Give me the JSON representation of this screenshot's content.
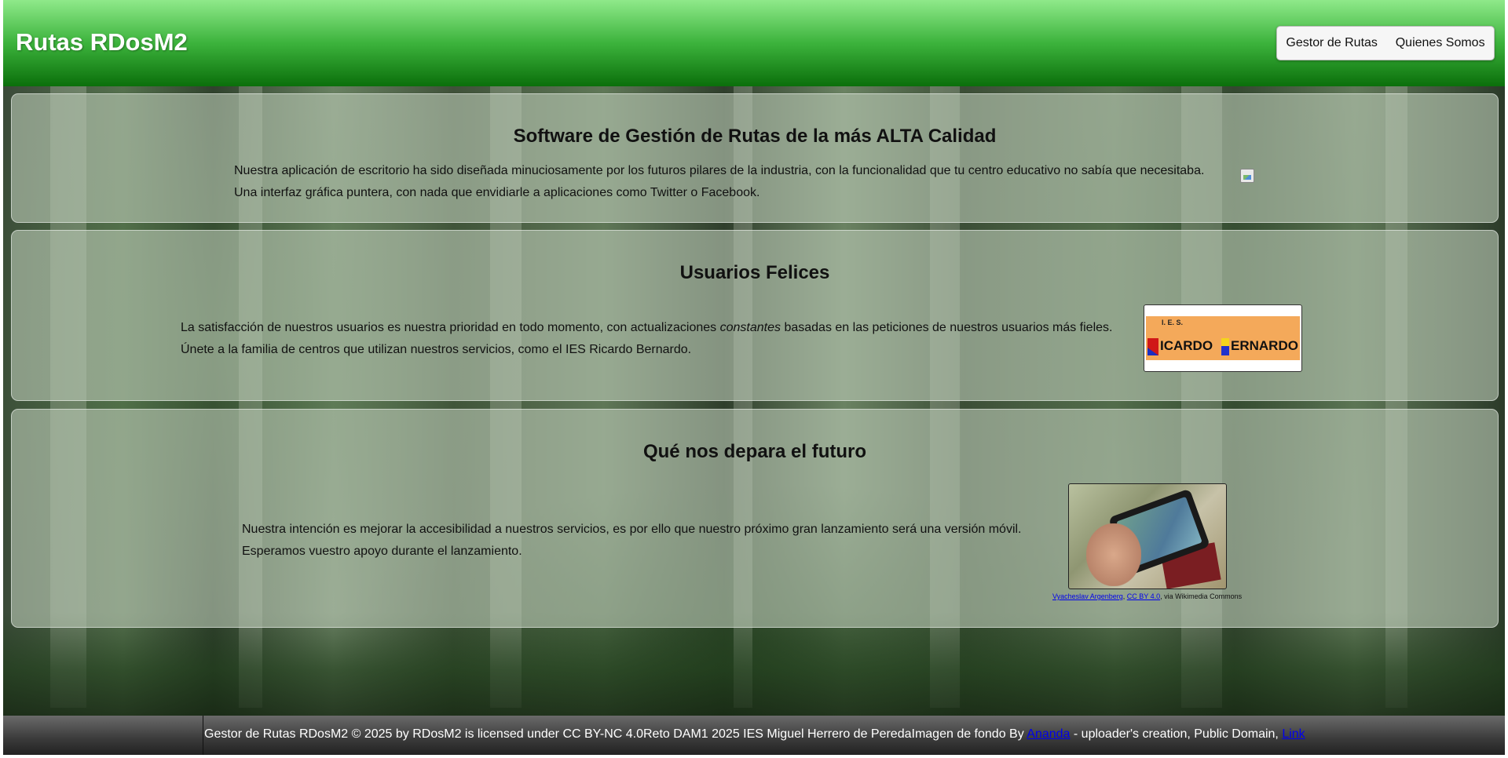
{
  "header": {
    "brand": "Rutas RDosM2",
    "nav": [
      "Gestor de Rutas",
      "Quienes Somos"
    ]
  },
  "sections": [
    {
      "title": "Software de Gestión de Rutas de la más ALTA Calidad",
      "line1": "Nuestra aplicación de escritorio ha sido diseñada minuciosamente por los futuros pilares de la industria, con la funcionalidad que tu centro educativo no sabía que necesitaba.",
      "line2": "Una interfaz gráfica puntera, con nada que envidiarle a aplicaciones como Twitter o Facebook."
    },
    {
      "title": "Usuarios Felices",
      "line1_pre": "La satisfacción de nuestros usuarios es nuestra prioridad en todo momento, con actualizaciones ",
      "line1_em": "constantes",
      "line1_post": " basadas en las peticiones de nuestros usuarios más fieles.",
      "line2": "Únete a la familia de centros que utilizan nuestros servicios, como el IES Ricardo Bernardo.",
      "logo": {
        "small": "I. E. S.",
        "big_1": "ICARDO",
        "big_2": "ERNARDO"
      }
    },
    {
      "title": "Qué nos depara el futuro",
      "line1": "Nuestra intención es mejorar la accesibilidad a nuestros servicios, es por ello que nuestro próximo gran lanzamiento será una versión móvil.",
      "line2": "Esperamos vuestro apoyo durante el lanzamiento.",
      "caption": {
        "author": "Vyacheslav Argenberg",
        "sep": ", ",
        "license": "CC BY 4.0",
        "suffix": ", via Wikimedia Commons"
      }
    }
  ],
  "footer": {
    "text": "Gestor de Rutas RDosM2 © 2025 by RDosM2 is licensed under CC BY-NC 4.0Reto DAM1 2025 IES Miguel Herrero de PeredaImagen de fondo By ",
    "author_link": "Ananda",
    "middle": " - uploader's creation, Public Domain, ",
    "link": "Link"
  },
  "colors": {
    "header_top": "#8fe98a",
    "header_bottom": "#0b6f0b",
    "panel_bg": "rgba(185,200,180,0.62)",
    "footer_bg": "#3a3a3a",
    "link": "#0000ee"
  }
}
